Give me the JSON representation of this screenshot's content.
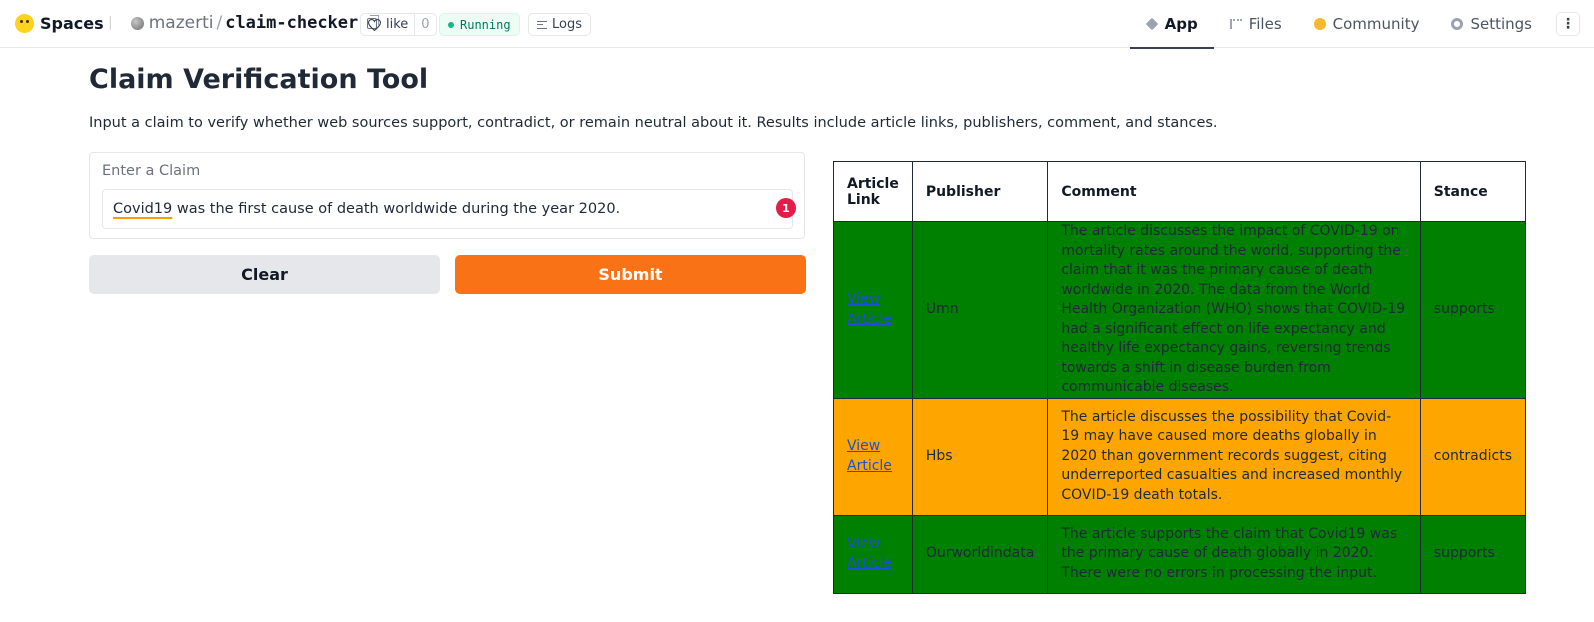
{
  "header": {
    "brand": "Spaces",
    "owner": "mazerti",
    "repo": "claim-checker",
    "like_label": "like",
    "like_count": "0",
    "status": "Running",
    "logs_label": "Logs",
    "nav": [
      {
        "label": "App",
        "icon": "app-icon",
        "active": true
      },
      {
        "label": "Files",
        "icon": "files-icon",
        "active": false
      },
      {
        "label": "Community",
        "icon": "community-icon",
        "active": false
      },
      {
        "label": "Settings",
        "icon": "settings-icon",
        "active": false
      }
    ],
    "more_label": "⋮"
  },
  "main": {
    "title": "Claim Verification Tool",
    "description": "Input a claim to verify whether web sources support, contradict, or remain neutral about it. Results include article links, publishers, comment, and stances.",
    "claim_label": "Enter a Claim",
    "claim_value_misspelled": "Covid19",
    "claim_value_rest": " was the first cause of death worldwide during the year 2020.",
    "error_badge": "1",
    "clear_label": "Clear",
    "submit_label": "Submit"
  },
  "table": {
    "headers": [
      "Article Link",
      "Publisher",
      "Comment",
      "Stance"
    ],
    "rows": [
      {
        "link": "View Article",
        "publisher": "Umn",
        "comment": "The article discusses the impact of COVID-19 on mortality rates around the world, supporting the claim that it was the primary cause of death worldwide in 2020. The data from the World Health Organization (WHO) shows that COVID-19 had a significant effect on life expectancy and healthy life expectancy gains, reversing trends towards a shift in disease burden from communicable diseases.",
        "stance": "supports",
        "color": "#008000"
      },
      {
        "link": "View Article",
        "publisher": "Hbs",
        "comment": "The article discusses the possibility that Covid-19 may have caused more deaths globally in 2020 than government records suggest, citing underreported casualties and increased monthly COVID-19 death totals.",
        "stance": "contradicts",
        "color": "#ffa500"
      },
      {
        "link": "View Article",
        "publisher": "Ourworldindata",
        "comment": "The article supports the claim that Covid19 was the primary cause of death globally in 2020. There were no errors in processing the input.",
        "stance": "supports",
        "color": "#008000"
      }
    ]
  }
}
